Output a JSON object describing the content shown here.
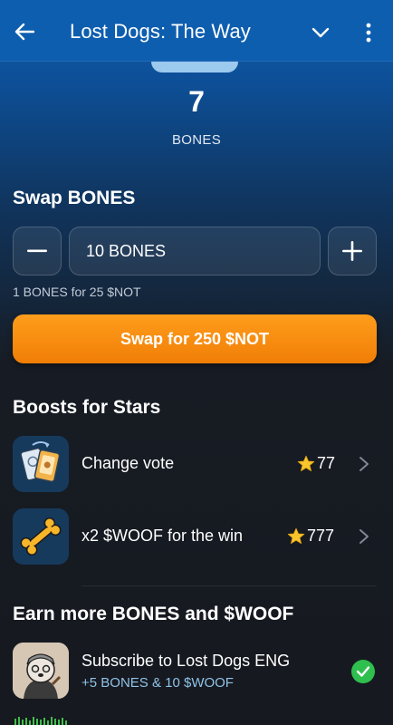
{
  "header": {
    "title": "Lost Dogs: The Way",
    "back_icon": "arrow-left-icon",
    "menu_icon": "chevron-down-icon",
    "more_icon": "more-vertical-icon"
  },
  "balance": {
    "value": "7",
    "unit": "BONES"
  },
  "swap": {
    "heading": "Swap BONES",
    "amount": "10 BONES",
    "rate": "1 BONES for 25 $NOT",
    "button_label": "Swap for 250 $NOT"
  },
  "boosts": {
    "heading": "Boosts for Stars",
    "items": [
      {
        "label": "Change vote",
        "price": "77",
        "icon": "vote-cards-icon"
      },
      {
        "label": "x2 $WOOF for the win",
        "price": "777",
        "icon": "bone-icon"
      }
    ]
  },
  "earn": {
    "heading": "Earn more BONES and $WOOF",
    "tasks": [
      {
        "title": "Subscribe to Lost Dogs ENG",
        "reward": "+5 BONES & 10 $WOOF",
        "status": "completed"
      }
    ]
  },
  "colors": {
    "header_bg": "#0e5eaf",
    "accent_orange": "#f58a0d",
    "success_green": "#2fbf4f",
    "star_gold": "#f7c52c"
  }
}
